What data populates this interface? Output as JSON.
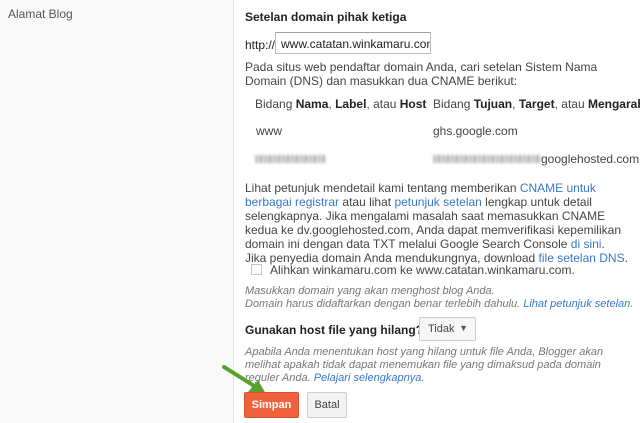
{
  "sidebar_label": "Alamat Blog",
  "heading": "Setelan domain pihak ketiga",
  "domain": {
    "prefix": "http://",
    "value": "www.catatan.winkamaru.com"
  },
  "intro": "Pada situs web pendaftar domain Anda, cari setelan Sistem Nama Domain (DNS) dan masukkan dua CNAME berikut:",
  "table": {
    "col1": {
      "pre": "Bidang ",
      "b1": "Nama",
      "m1": ", ",
      "b2": "Label",
      "m2": ", atau ",
      "b3": "Host"
    },
    "col2": {
      "pre": "Bidang ",
      "b1": "Tujuan",
      "m1": ", ",
      "b2": "Target",
      "m2": ", atau ",
      "b3": "Mengarah k"
    },
    "row1": {
      "name": "www",
      "target": "ghs.google.com"
    },
    "row2": {
      "target_suffix": "googlehosted.com"
    }
  },
  "instructions": {
    "t1": "Lihat petunjuk mendetail kami tentang memberikan ",
    "l1": "CNAME untuk berbagai registrar",
    "t2": " atau lihat ",
    "l2": "petunjuk setelan",
    "t3": " lengkap untuk detail selengkapnya. Jika mengalami masalah saat memasukkan CNAME kedua ke dv.googlehosted.com, Anda dapat memverifikasi kepemilikan domain ini dengan data TXT melalui Google Search Console ",
    "l3": "di sini",
    "t4": ".",
    "t5": "Jika penyedia domain Anda mendukungnya, download ",
    "l4": "file setelan DNS",
    "t6": "."
  },
  "redirect_label": "Alihkan winkamaru.com ke www.catatan.winkamaru.com.",
  "hint1": {
    "line1": "Masukkan domain yang akan menghost blog Anda.",
    "line2": "Domain harus didaftarkan dengan benar terlebih dahulu. ",
    "link": "Lihat petunjuk setelan",
    "end": "."
  },
  "missing_host": {
    "label": "Gunakan host file yang hilang?",
    "selected": "Tidak"
  },
  "hint2": {
    "text": "Apabila Anda menentukan host yang hilang untuk file Anda, Blogger akan melihat apakah tidak dapat menemukan file yang dimaksud pada domain reguler Anda. ",
    "link": "Pelajari selengkapnya",
    "end": "."
  },
  "buttons": {
    "save": "Simpan",
    "cancel": "Batal"
  },
  "colors": {
    "accent": "#f0623e",
    "link": "#3a77c8",
    "arrow": "#5aa02c"
  }
}
